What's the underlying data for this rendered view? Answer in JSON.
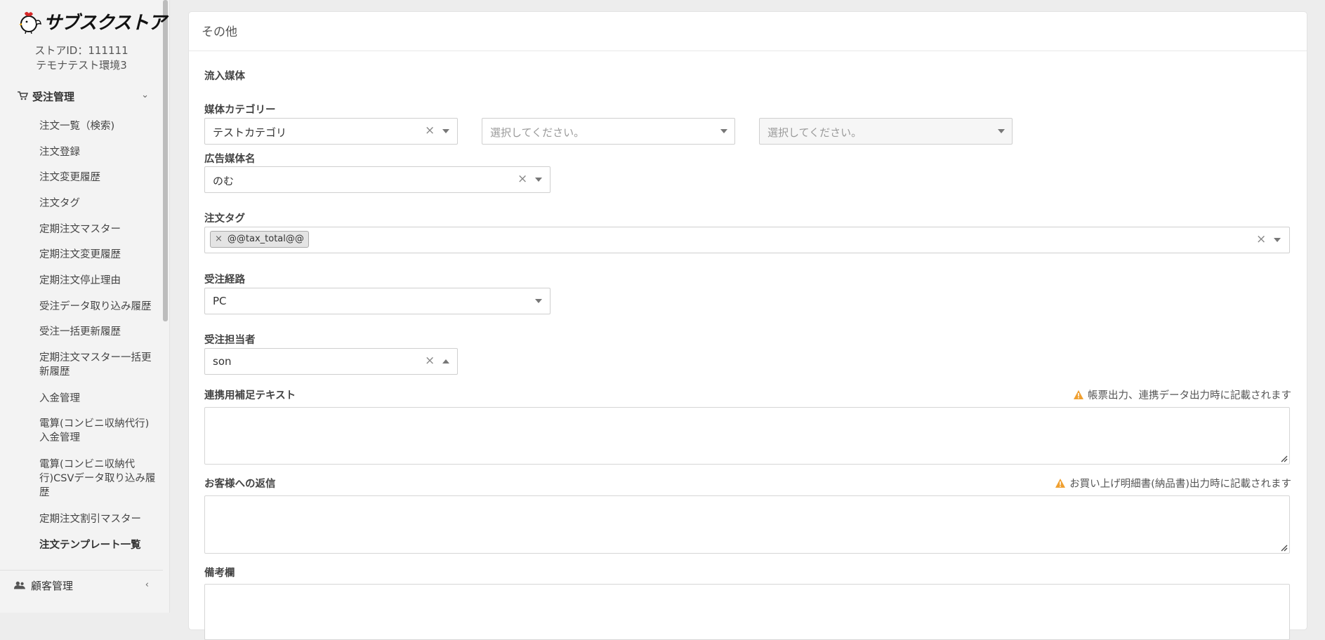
{
  "sidebar": {
    "logo_text": "サブスクストア",
    "store_id": "ストアID：111111",
    "store_name": "テモナテスト環境3",
    "orders_group": {
      "label": "受注管理",
      "icon": "cart-icon",
      "chevron": "⌄"
    },
    "items": [
      {
        "label": "注文一覧（検索)"
      },
      {
        "label": "注文登録"
      },
      {
        "label": "注文変更履歴"
      },
      {
        "label": "注文タグ"
      },
      {
        "label": "定期注文マスター"
      },
      {
        "label": "定期注文変更履歴"
      },
      {
        "label": "定期注文停止理由"
      },
      {
        "label": "受注データ取り込み履歴"
      },
      {
        "label": "受注一括更新履歴"
      },
      {
        "label": "定期注文マスター一括更新履歴"
      },
      {
        "label": "入金管理"
      },
      {
        "label": "電算(コンビニ収納代行)入金管理"
      },
      {
        "label": "電算(コンビニ収納代行)CSVデータ取り込み履歴"
      },
      {
        "label": "定期注文割引マスター"
      },
      {
        "label": "注文テンプレート一覧"
      }
    ],
    "customers_group": {
      "label": "顧客管理",
      "icon": "users-icon",
      "chevron": "‹"
    }
  },
  "main": {
    "card_title": "その他",
    "section_title": "流入媒体",
    "media_category": {
      "label": "媒体カテゴリー",
      "select1_value": "テストカテゴリ",
      "select2_placeholder": "選択してください。",
      "select3_placeholder": "選択してください。"
    },
    "ad_media": {
      "label": "広告媒体名",
      "value": "のむ"
    },
    "order_tag": {
      "label": "注文タグ",
      "tags": [
        "@@tax_total@@"
      ]
    },
    "order_route": {
      "label": "受注経路",
      "value": "PC"
    },
    "order_staff": {
      "label": "受注担当者",
      "value": "son"
    },
    "link_text": {
      "label": "連携用補足テキスト",
      "note": "帳票出力、連携データ出力時に記載されます"
    },
    "customer_reply": {
      "label": "お客様への返信",
      "note": "お買い上げ明細書(納品書)出力時に記載されます"
    },
    "remarks": {
      "label": "備考欄"
    }
  },
  "colors": {
    "warning": "#f0a030",
    "sidebar_bg": "#f3f3f3",
    "page_bg": "#ededed"
  }
}
